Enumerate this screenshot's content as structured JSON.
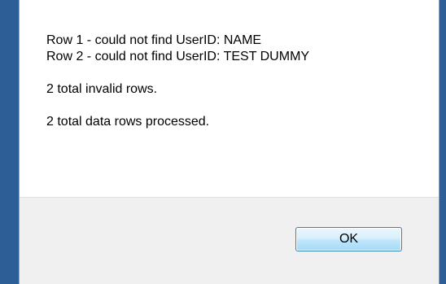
{
  "dialog": {
    "messages": [
      "Row 1 - could not find UserID: NAME",
      "Row 2 - could not find UserID: TEST DUMMY",
      "2 total invalid rows.",
      "2 total data rows processed."
    ],
    "ok_label": "OK"
  },
  "colors": {
    "background": "#2d5f97",
    "dialog_background": "#ffffff",
    "footer_background": "#f0f0f0",
    "button_border": "#3c7fb1"
  }
}
